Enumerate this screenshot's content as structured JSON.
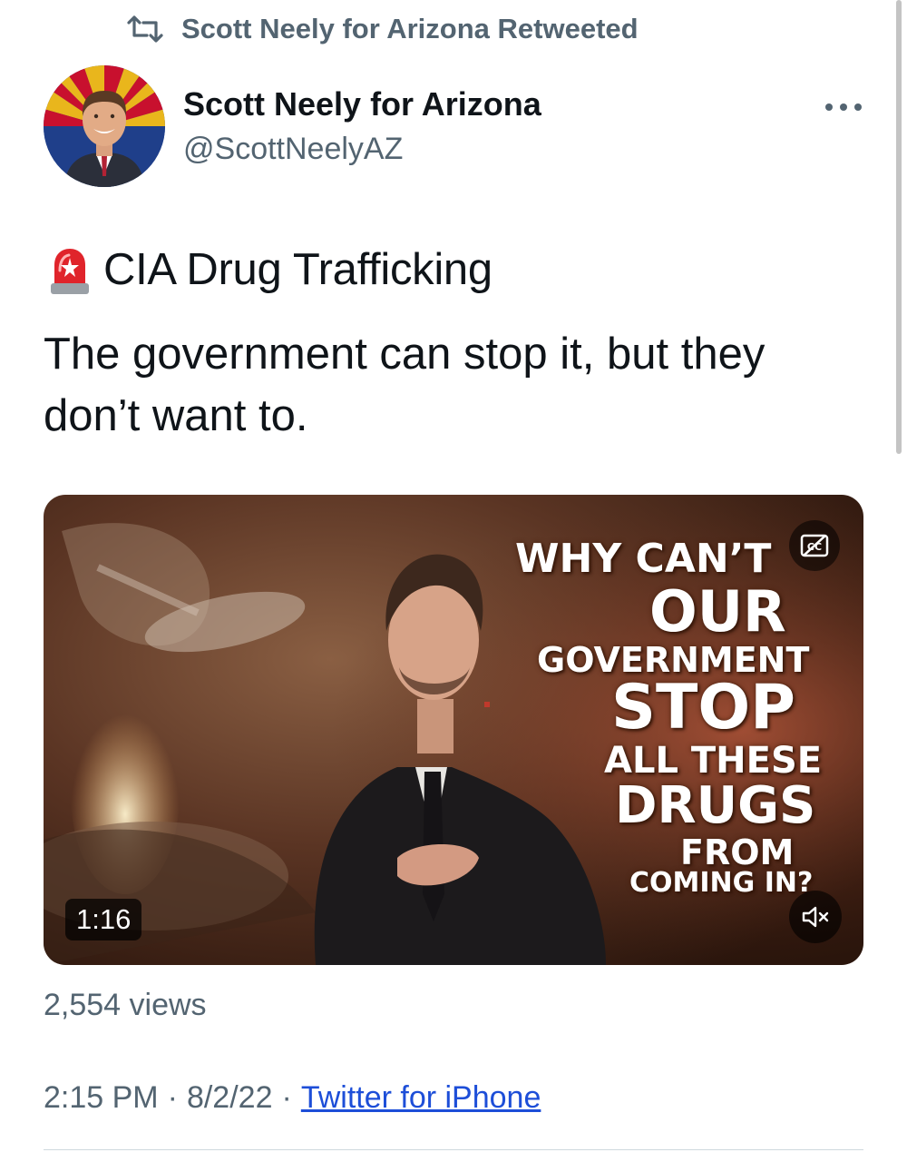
{
  "retweet": {
    "text": "Scott Neely for Arizona Retweeted",
    "icon": "retweet-icon"
  },
  "author": {
    "name": "Scott Neely for Arizona",
    "handle": "@ScottNeelyAZ",
    "avatar_icon": "avatar-photo"
  },
  "more_icon": "more-options-icon",
  "tweet": {
    "headline_emoji": "police-light-icon",
    "headline": "CIA Drug Trafficking",
    "body": "The government can stop it, but they don’t want to."
  },
  "video": {
    "overlay_lines": [
      "WHY CAN’T",
      "OUR",
      "GOVERNMENT",
      "STOP",
      "ALL THESE",
      "DRUGS",
      "FROM",
      "COMING IN?"
    ],
    "duration": "1:16",
    "cc_icon": "closed-captions-icon",
    "mute_icon": "muted-speaker-icon"
  },
  "stats": {
    "views": "2,554 views"
  },
  "meta": {
    "time": "2:15 PM",
    "separator": "·",
    "date": "8/2/22",
    "source": "Twitter for iPhone"
  },
  "colors": {
    "text": "#0f1419",
    "secondary": "#536471",
    "link": "#1d4ed8"
  }
}
